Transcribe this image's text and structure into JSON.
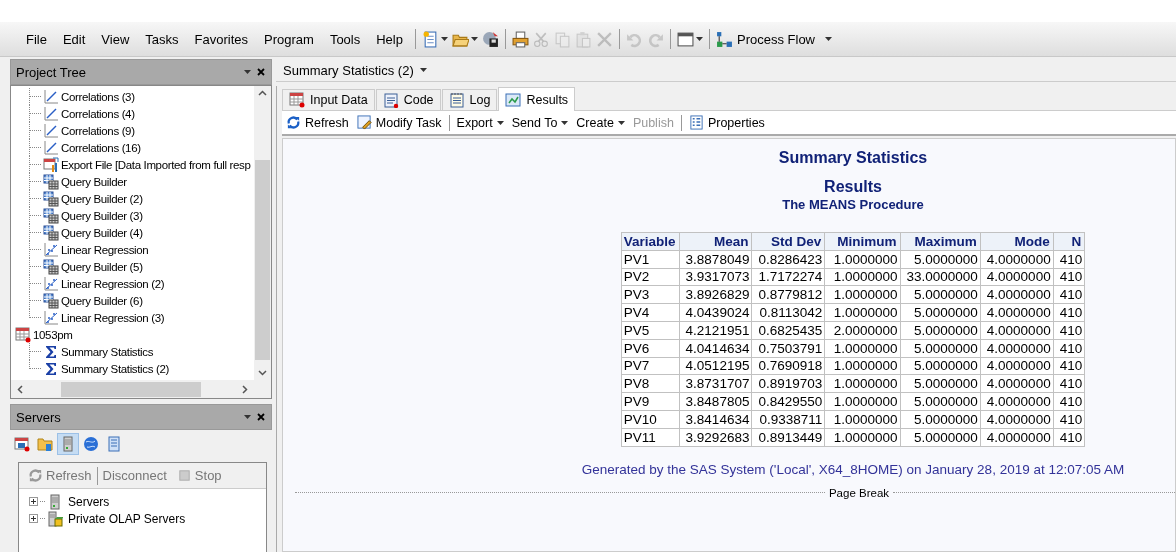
{
  "menu": [
    "File",
    "Edit",
    "View",
    "Tasks",
    "Favorites",
    "Program",
    "Tools",
    "Help"
  ],
  "toolbar": [
    [
      {
        "kind": "new",
        "dropdown": true,
        "disabled": false
      },
      {
        "kind": "open",
        "dropdown": true,
        "disabled": false
      },
      {
        "kind": "save",
        "dropdown": false,
        "disabled": false
      }
    ],
    [
      {
        "kind": "print",
        "dropdown": false,
        "disabled": false
      },
      {
        "kind": "cut",
        "dropdown": false,
        "disabled": true
      },
      {
        "kind": "copy",
        "dropdown": false,
        "disabled": true
      },
      {
        "kind": "paste",
        "dropdown": false,
        "disabled": true
      },
      {
        "kind": "delete",
        "dropdown": false,
        "disabled": true
      }
    ],
    [
      {
        "kind": "undo",
        "dropdown": false,
        "disabled": true
      },
      {
        "kind": "redo",
        "dropdown": false,
        "disabled": true
      }
    ],
    [
      {
        "kind": "window",
        "dropdown": true,
        "disabled": false
      }
    ],
    [
      {
        "kind": "flow",
        "label": "Process Flow",
        "dropdown": true,
        "disabled": false
      }
    ]
  ],
  "project_tree": {
    "title": "Project Tree",
    "items": [
      {
        "children": [
          {
            "label": "Correlations (3)",
            "kind": "correlation"
          },
          {
            "label": "Correlations (4)",
            "kind": "correlation"
          },
          {
            "label": "Correlations (9)",
            "kind": "correlation"
          },
          {
            "label": "Correlations (16)",
            "kind": "correlation"
          },
          {
            "label": "Export File [Data Imported from full resp",
            "kind": "export"
          },
          {
            "label": "Query Builder",
            "kind": "query"
          },
          {
            "label": "Query Builder (2)",
            "kind": "query"
          },
          {
            "label": "Query Builder (3)",
            "kind": "query"
          },
          {
            "label": "Query Builder (4)",
            "kind": "query"
          },
          {
            "label": "Linear Regression",
            "kind": "regression"
          },
          {
            "label": "Query Builder (5)",
            "kind": "query"
          },
          {
            "label": "Linear Regression (2)",
            "kind": "regression"
          },
          {
            "label": "Query Builder (6)",
            "kind": "query"
          },
          {
            "label": "Linear Regression (3)",
            "kind": "regression"
          }
        ]
      },
      {
        "label": "1053pm",
        "kind": "data",
        "children": [
          {
            "label": "Summary Statistics",
            "kind": "summary"
          },
          {
            "label": "Summary Statistics (2)",
            "kind": "summary"
          }
        ]
      }
    ]
  },
  "servers": {
    "title": "Servers",
    "tools": [
      {
        "kind": "tasks",
        "selected": false
      },
      {
        "kind": "folder",
        "selected": false
      },
      {
        "kind": "server",
        "selected": true
      },
      {
        "kind": "globe",
        "selected": false
      },
      {
        "kind": "list",
        "selected": false
      }
    ],
    "actions": [
      {
        "label": "Refresh",
        "kind": "refresh",
        "disabled": true
      },
      {
        "label": "Disconnect",
        "kind": "text",
        "disabled": true
      },
      {
        "label": "Stop",
        "kind": "stop",
        "disabled": true
      }
    ],
    "items": [
      {
        "label": "Servers",
        "kind": "server",
        "expanded": false
      },
      {
        "label": "Private OLAP Servers",
        "kind": "olap",
        "expanded": false
      }
    ]
  },
  "document": {
    "title": "Summary Statistics (2)",
    "tabs": [
      {
        "label": "Input Data",
        "kind": "data",
        "selected": false
      },
      {
        "label": "Code",
        "kind": "code",
        "selected": false
      },
      {
        "label": "Log",
        "kind": "log",
        "selected": false
      },
      {
        "label": "Results",
        "kind": "results",
        "selected": true
      }
    ],
    "actions": [
      {
        "label": "Refresh",
        "kind": "refresh",
        "dropdown": false,
        "disabled": false
      },
      {
        "label": "Modify Task",
        "kind": "modify",
        "dropdown": false,
        "disabled": false
      },
      {
        "kind": "separator"
      },
      {
        "label": "Export",
        "kind": "text",
        "dropdown": true,
        "disabled": false
      },
      {
        "label": "Send To",
        "kind": "text",
        "dropdown": true,
        "disabled": false
      },
      {
        "label": "Create",
        "kind": "text",
        "dropdown": true,
        "disabled": false
      },
      {
        "label": "Publish",
        "kind": "text",
        "dropdown": false,
        "disabled": true
      },
      {
        "kind": "separator"
      },
      {
        "label": "Properties",
        "kind": "properties",
        "dropdown": false,
        "disabled": false
      }
    ],
    "output": {
      "titles": [
        "Summary Statistics",
        "Results"
      ],
      "procedure": "The MEANS Procedure",
      "columns": [
        "Variable",
        "Mean",
        "Std Dev",
        "Minimum",
        "Maximum",
        "Mode",
        "N"
      ],
      "rows": [
        [
          "PV1",
          "3.8878049",
          "0.8286423",
          "1.0000000",
          "5.0000000",
          "4.0000000",
          "410"
        ],
        [
          "PV2",
          "3.9317073",
          "1.7172274",
          "1.0000000",
          "33.0000000",
          "4.0000000",
          "410"
        ],
        [
          "PV3",
          "3.8926829",
          "0.8779812",
          "1.0000000",
          "5.0000000",
          "4.0000000",
          "410"
        ],
        [
          "PV4",
          "4.0439024",
          "0.8113042",
          "1.0000000",
          "5.0000000",
          "4.0000000",
          "410"
        ],
        [
          "PV5",
          "4.2121951",
          "0.6825435",
          "2.0000000",
          "5.0000000",
          "4.0000000",
          "410"
        ],
        [
          "PV6",
          "4.0414634",
          "0.7503791",
          "1.0000000",
          "5.0000000",
          "4.0000000",
          "410"
        ],
        [
          "PV7",
          "4.0512195",
          "0.7690918",
          "1.0000000",
          "5.0000000",
          "4.0000000",
          "410"
        ],
        [
          "PV8",
          "3.8731707",
          "0.8919703",
          "1.0000000",
          "5.0000000",
          "4.0000000",
          "410"
        ],
        [
          "PV9",
          "3.8487805",
          "0.8429550",
          "1.0000000",
          "5.0000000",
          "4.0000000",
          "410"
        ],
        [
          "PV10",
          "3.8414634",
          "0.9338711",
          "1.0000000",
          "5.0000000",
          "4.0000000",
          "410"
        ],
        [
          "PV11",
          "3.9292683",
          "0.8913449",
          "1.0000000",
          "5.0000000",
          "4.0000000",
          "410"
        ]
      ],
      "footnote": "Generated by the SAS System ('Local', X64_8HOME) on January 28, 2019 at 12:07:05 AM",
      "page_break": "Page Break"
    }
  }
}
